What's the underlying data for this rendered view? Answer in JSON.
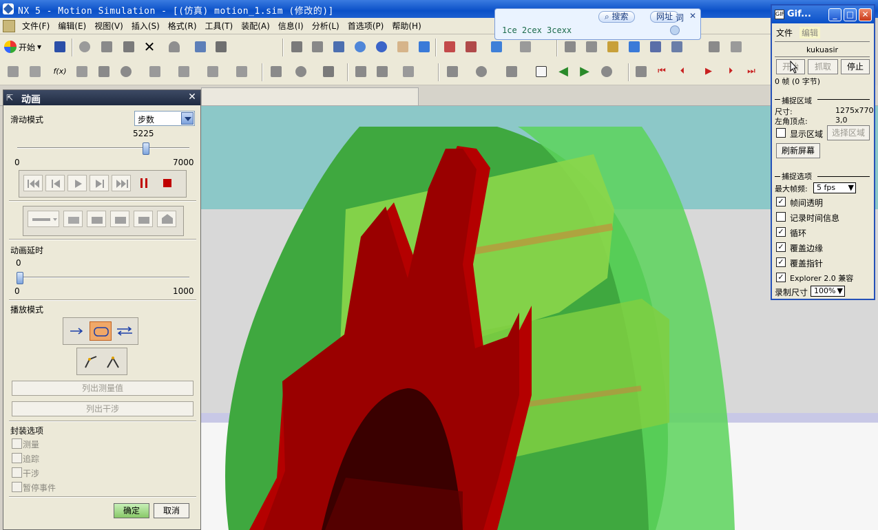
{
  "window": {
    "title": "NX 5 - Motion Simulation - [(仿真) motion_1.sim (修改的)]"
  },
  "menu": {
    "items": [
      "文件(F)",
      "编辑(E)",
      "视图(V)",
      "插入(S)",
      "格式(R)",
      "工具(T)",
      "装配(A)",
      "信息(I)",
      "分析(L)",
      "首选项(P)",
      "帮助(H)"
    ]
  },
  "toolbar": {
    "start_label": "开始"
  },
  "search_popup": {
    "search_label": "搜索",
    "url_label": "网址",
    "dict_label": "词",
    "query": "1ce 2cex 3cexx"
  },
  "animation_dialog": {
    "title": "动画",
    "slide_mode_label": "滑动模式",
    "slide_mode_value": "步数",
    "step_value": "5225",
    "step_min": "0",
    "step_max": "7000",
    "step_fraction": 0.746,
    "delay_label": "动画延时",
    "delay_value": "0",
    "delay_min": "0",
    "delay_max": "1000",
    "delay_fraction": 0.0,
    "playback_mode_label": "播放模式",
    "list_measure_label": "列出测量值",
    "list_interference_label": "列出干涉",
    "envelope_label": "封装选项",
    "envelope_options": [
      "测量",
      "追踪",
      "干涉",
      "暂停事件"
    ],
    "ok_label": "确定",
    "cancel_label": "取消"
  },
  "gif_panel": {
    "title": "Gif...",
    "menu_file": "文件",
    "menu_edit": "编辑",
    "user": "kukuasir",
    "start_label": "开始",
    "capture_label": "抓取",
    "stop_label": "停止",
    "frames_text": "0 帧 (0 字节)",
    "capture_area_label": "捕捉区域",
    "size_label": "尺寸:",
    "size_value": "1275x770",
    "corner_label": "左角顶点:",
    "corner_value": "3,0",
    "show_area_label": "显示区域",
    "select_area_label": "选择区域",
    "refresh_label": "刷新屏幕",
    "capture_options_label": "捕捉选项",
    "max_fps_label": "最大帧频:",
    "max_fps_value": "5 fps",
    "options": [
      {
        "label": "帧间透明",
        "checked": true
      },
      {
        "label": "记录时间信息",
        "checked": false
      },
      {
        "label": "循环",
        "checked": true
      },
      {
        "label": "覆盖边缘",
        "checked": true
      },
      {
        "label": "覆盖指针",
        "checked": true
      },
      {
        "label": "Explorer 2.0 兼容",
        "checked": true
      }
    ],
    "record_size_label": "录制尺寸",
    "record_size_value": "100%"
  },
  "colors": {
    "gear_red": "#a00000",
    "ring_green": "#3fbf3f",
    "sky_teal": "#8cc8c8",
    "titlebar_blue": "#0a50c8"
  }
}
